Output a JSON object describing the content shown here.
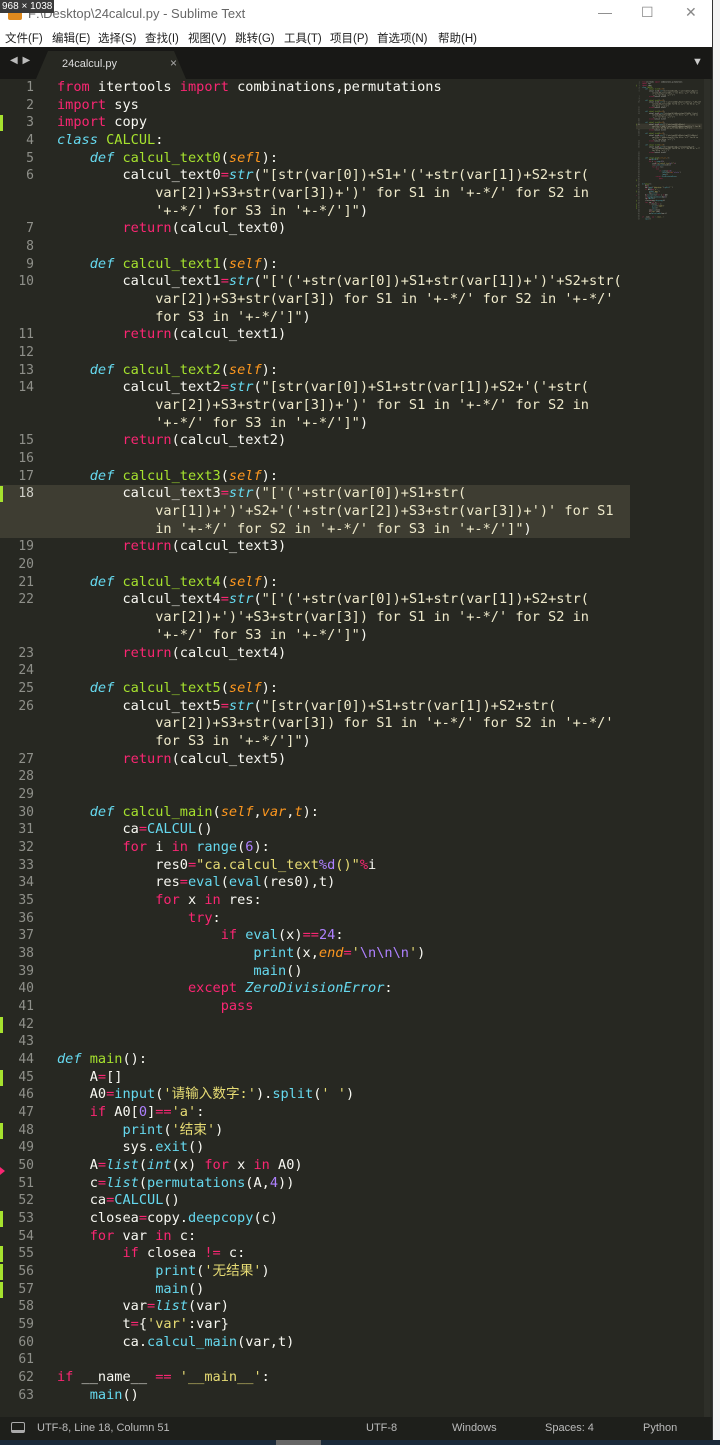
{
  "window": {
    "title": "F:\\Desktop\\24calcul.py - Sublime Text",
    "size_overlay": "968 × 1038",
    "minimize": "—",
    "maximize": "☐",
    "close": "✕"
  },
  "menu": [
    "文件(F)",
    "编辑(E)",
    "选择(S)",
    "查找(I)",
    "视图(V)",
    "跳转(G)",
    "工具(T)",
    "项目(P)",
    "首选项(N)",
    "帮助(H)"
  ],
  "tabs": {
    "nav": "◀ ▶",
    "active": "24calcul.py",
    "close": "×",
    "dropdown": "▼"
  },
  "editor": {
    "current_line": 18,
    "modified_lines": [
      3,
      18,
      42,
      45,
      48,
      53,
      55,
      56,
      57
    ],
    "deleted_marker_line": 50,
    "rows": [
      {
        "n": 1,
        "t": "⟦k|from⟧ itertools ⟦k|import⟧ combinations,permutations"
      },
      {
        "n": 2,
        "t": "⟦k|import⟧ sys"
      },
      {
        "n": 3,
        "t": "⟦k|import⟧ copy"
      },
      {
        "n": 4,
        "t": "⟦d|class⟧ ⟦f|CALCUL⟧:"
      },
      {
        "n": 5,
        "t": "    ⟦d|def⟧ ⟦f|calcul_text0⟧(⟦p|sefl⟧):"
      },
      {
        "n": 6,
        "t": "        calcul_text0⟦k|=⟧⟦b|str⟧(⟦q|\"[str(var[0])+S1+'('+str(var[1])+S2+str(⟧"
      },
      {
        "n": "",
        "l": 6,
        "t": "            ⟦q|var[2])+S3+str(var[3])+')' for S1 in '+-*/' for S2 in⟧"
      },
      {
        "n": "",
        "l": 6,
        "t": "            ⟦q|'+-*/' for S3 in '+-*/']\"⟧)"
      },
      {
        "n": 7,
        "t": "        ⟦k|return⟧(calcul_text0)"
      },
      {
        "n": 8,
        "t": ""
      },
      {
        "n": 9,
        "t": "    ⟦d|def⟧ ⟦f|calcul_text1⟧(⟦p|self⟧):"
      },
      {
        "n": 10,
        "t": "        calcul_text1⟦k|=⟧⟦b|str⟧(⟦q|\"['('+str(var[0])+S1+str(var[1])+')'+S2+str(⟧"
      },
      {
        "n": "",
        "l": 10,
        "t": "            ⟦q|var[2])+S3+str(var[3]) for S1 in '+-*/' for S2 in '+-*/'⟧"
      },
      {
        "n": "",
        "l": 10,
        "t": "            ⟦q|for S3 in '+-*/']\"⟧)"
      },
      {
        "n": 11,
        "t": "        ⟦k|return⟧(calcul_text1)"
      },
      {
        "n": 12,
        "t": ""
      },
      {
        "n": 13,
        "t": "    ⟦d|def⟧ ⟦f|calcul_text2⟧(⟦p|self⟧):"
      },
      {
        "n": 14,
        "t": "        calcul_text2⟦k|=⟧⟦b|str⟧(⟦q|\"[str(var[0])+S1+str(var[1])+S2+'('+str(⟧"
      },
      {
        "n": "",
        "l": 14,
        "t": "            ⟦q|var[2])+S3+str(var[3])+')' for S1 in '+-*/' for S2 in⟧"
      },
      {
        "n": "",
        "l": 14,
        "t": "            ⟦q|'+-*/' for S3 in '+-*/']\"⟧)"
      },
      {
        "n": 15,
        "t": "        ⟦k|return⟧(calcul_text2)"
      },
      {
        "n": 16,
        "t": ""
      },
      {
        "n": 17,
        "t": "    ⟦d|def⟧ ⟦f|calcul_text3⟧(⟦p|self⟧):"
      },
      {
        "n": 18,
        "t": "        calcul_text3⟦k|=⟧⟦b|str⟧(⟦q|\"['('+str(var[0])+S1+str(⟧"
      },
      {
        "n": "",
        "l": 18,
        "t": "            ⟦q|var[1])+')'+S2+'('+str(var[2])+S3+str(var[3])+')' for S1⟧"
      },
      {
        "n": "",
        "l": 18,
        "t": "            ⟦q|in '+-*/' for S2 in '+-*/' for S3 in '+-*/']\"⟧)"
      },
      {
        "n": 19,
        "t": "        ⟦k|return⟧(calcul_text3)"
      },
      {
        "n": 20,
        "t": ""
      },
      {
        "n": 21,
        "t": "    ⟦d|def⟧ ⟦f|calcul_text4⟧(⟦p|self⟧):"
      },
      {
        "n": 22,
        "t": "        calcul_text4⟦k|=⟧⟦b|str⟧(⟦q|\"['('+str(var[0])+S1+str(var[1])+S2+str(⟧"
      },
      {
        "n": "",
        "l": 22,
        "t": "            ⟦q|var[2])+')'+S3+str(var[3]) for S1 in '+-*/' for S2 in⟧"
      },
      {
        "n": "",
        "l": 22,
        "t": "            ⟦q|'+-*/' for S3 in '+-*/']\"⟧)"
      },
      {
        "n": 23,
        "t": "        ⟦k|return⟧(calcul_text4)"
      },
      {
        "n": 24,
        "t": ""
      },
      {
        "n": 25,
        "t": "    ⟦d|def⟧ ⟦f|calcul_text5⟧(⟦p|self⟧):"
      },
      {
        "n": 26,
        "t": "        calcul_text5⟦k|=⟧⟦b|str⟧(⟦q|\"[str(var[0])+S1+str(var[1])+S2+str(⟧"
      },
      {
        "n": "",
        "l": 26,
        "t": "            ⟦q|var[2])+S3+str(var[3]) for S1 in '+-*/' for S2 in '+-*/'⟧"
      },
      {
        "n": "",
        "l": 26,
        "t": "            ⟦q|for S3 in '+-*/']\"⟧)"
      },
      {
        "n": 27,
        "t": "        ⟦k|return⟧(calcul_text5)"
      },
      {
        "n": 28,
        "t": ""
      },
      {
        "n": 29,
        "t": ""
      },
      {
        "n": 30,
        "t": "    ⟦d|def⟧ ⟦f|calcul_main⟧(⟦p|self⟧,⟦p|var⟧,⟦p|t⟧):"
      },
      {
        "n": 31,
        "t": "        ca⟦k|=⟧⟦c|CALCUL⟧()"
      },
      {
        "n": 32,
        "t": "        ⟦k|for⟧ i ⟦k|in⟧ ⟦c|range⟧(⟦n|6⟧):"
      },
      {
        "n": 33,
        "t": "            res0⟦k|=⟧⟦s|\"ca.calcul_text⟧⟦n|%d⟧⟦s|()\"⟧⟦k|%⟧i"
      },
      {
        "n": 34,
        "t": "            res⟦k|=⟧⟦c|eval⟧(⟦c|eval⟧(res0),t)"
      },
      {
        "n": 35,
        "t": "            ⟦k|for⟧ x ⟦k|in⟧ res:"
      },
      {
        "n": 36,
        "t": "                ⟦k|try⟧:"
      },
      {
        "n": 37,
        "t": "                    ⟦k|if⟧ ⟦c|eval⟧(x)⟦k|==⟧⟦n|24⟧:"
      },
      {
        "n": 38,
        "t": "                        ⟦c|print⟧(x,⟦p|end⟧⟦k|=⟧⟦s|'⟧⟦n|\\n\\n\\n⟧⟦s|'⟧)"
      },
      {
        "n": 39,
        "t": "                        ⟦c|main⟧()"
      },
      {
        "n": 40,
        "t": "                ⟦k|except⟧ ⟦b|ZeroDivisionError⟧:"
      },
      {
        "n": 41,
        "t": "                    ⟦k|pass⟧"
      },
      {
        "n": 42,
        "t": ""
      },
      {
        "n": 43,
        "t": ""
      },
      {
        "n": 44,
        "t": "⟦d|def⟧ ⟦f|main⟧():"
      },
      {
        "n": 45,
        "t": "    A⟦k|=⟧[]"
      },
      {
        "n": 46,
        "t": "    A0⟦k|=⟧⟦c|input⟧(⟦s|'请输入数字:'⟧).⟦c|split⟧(⟦s|' '⟧)"
      },
      {
        "n": 47,
        "t": "    ⟦k|if⟧ A0[⟦n|0⟧]⟦k|==⟧⟦s|'a'⟧:"
      },
      {
        "n": 48,
        "t": "        ⟦c|print⟧(⟦s|'结束'⟧)"
      },
      {
        "n": 49,
        "t": "        sys.⟦c|exit⟧()"
      },
      {
        "n": 50,
        "t": "    A⟦k|=⟧⟦b|list⟧(⟦b|int⟧(x) ⟦k|for⟧ x ⟦k|in⟧ A0)"
      },
      {
        "n": 51,
        "t": "    c⟦k|=⟧⟦b|list⟧(⟦c|permutations⟧(A,⟦n|4⟧))"
      },
      {
        "n": 52,
        "t": "    ca⟦k|=⟧⟦c|CALCUL⟧()"
      },
      {
        "n": 53,
        "t": "    closea⟦k|=⟧copy.⟦c|deepcopy⟧(c)"
      },
      {
        "n": 54,
        "t": "    ⟦k|for⟧ var ⟦k|in⟧ c:"
      },
      {
        "n": 55,
        "t": "        ⟦k|if⟧ closea ⟦k|!=⟧ c:"
      },
      {
        "n": 56,
        "t": "            ⟦c|print⟧(⟦s|'无结果'⟧)"
      },
      {
        "n": 57,
        "t": "            ⟦c|main⟧()"
      },
      {
        "n": 58,
        "t": "        var⟦k|=⟧⟦b|list⟧(var)"
      },
      {
        "n": 59,
        "t": "        t⟦k|=⟧{⟦s|'var'⟧:var}"
      },
      {
        "n": 60,
        "t": "        ca.⟦c|calcul_main⟧(var,t)"
      },
      {
        "n": 61,
        "t": ""
      },
      {
        "n": 62,
        "t": "⟦k|if⟧ __name__ ⟦k|==⟧ ⟦s|'__main__'⟧:"
      },
      {
        "n": 63,
        "t": "    ⟦c|main⟧()"
      }
    ]
  },
  "status": {
    "position": "UTF-8, Line 18, Column 51",
    "encoding": "UTF-8",
    "line_endings": "Windows",
    "indent": "Spaces: 4",
    "syntax": "Python"
  }
}
